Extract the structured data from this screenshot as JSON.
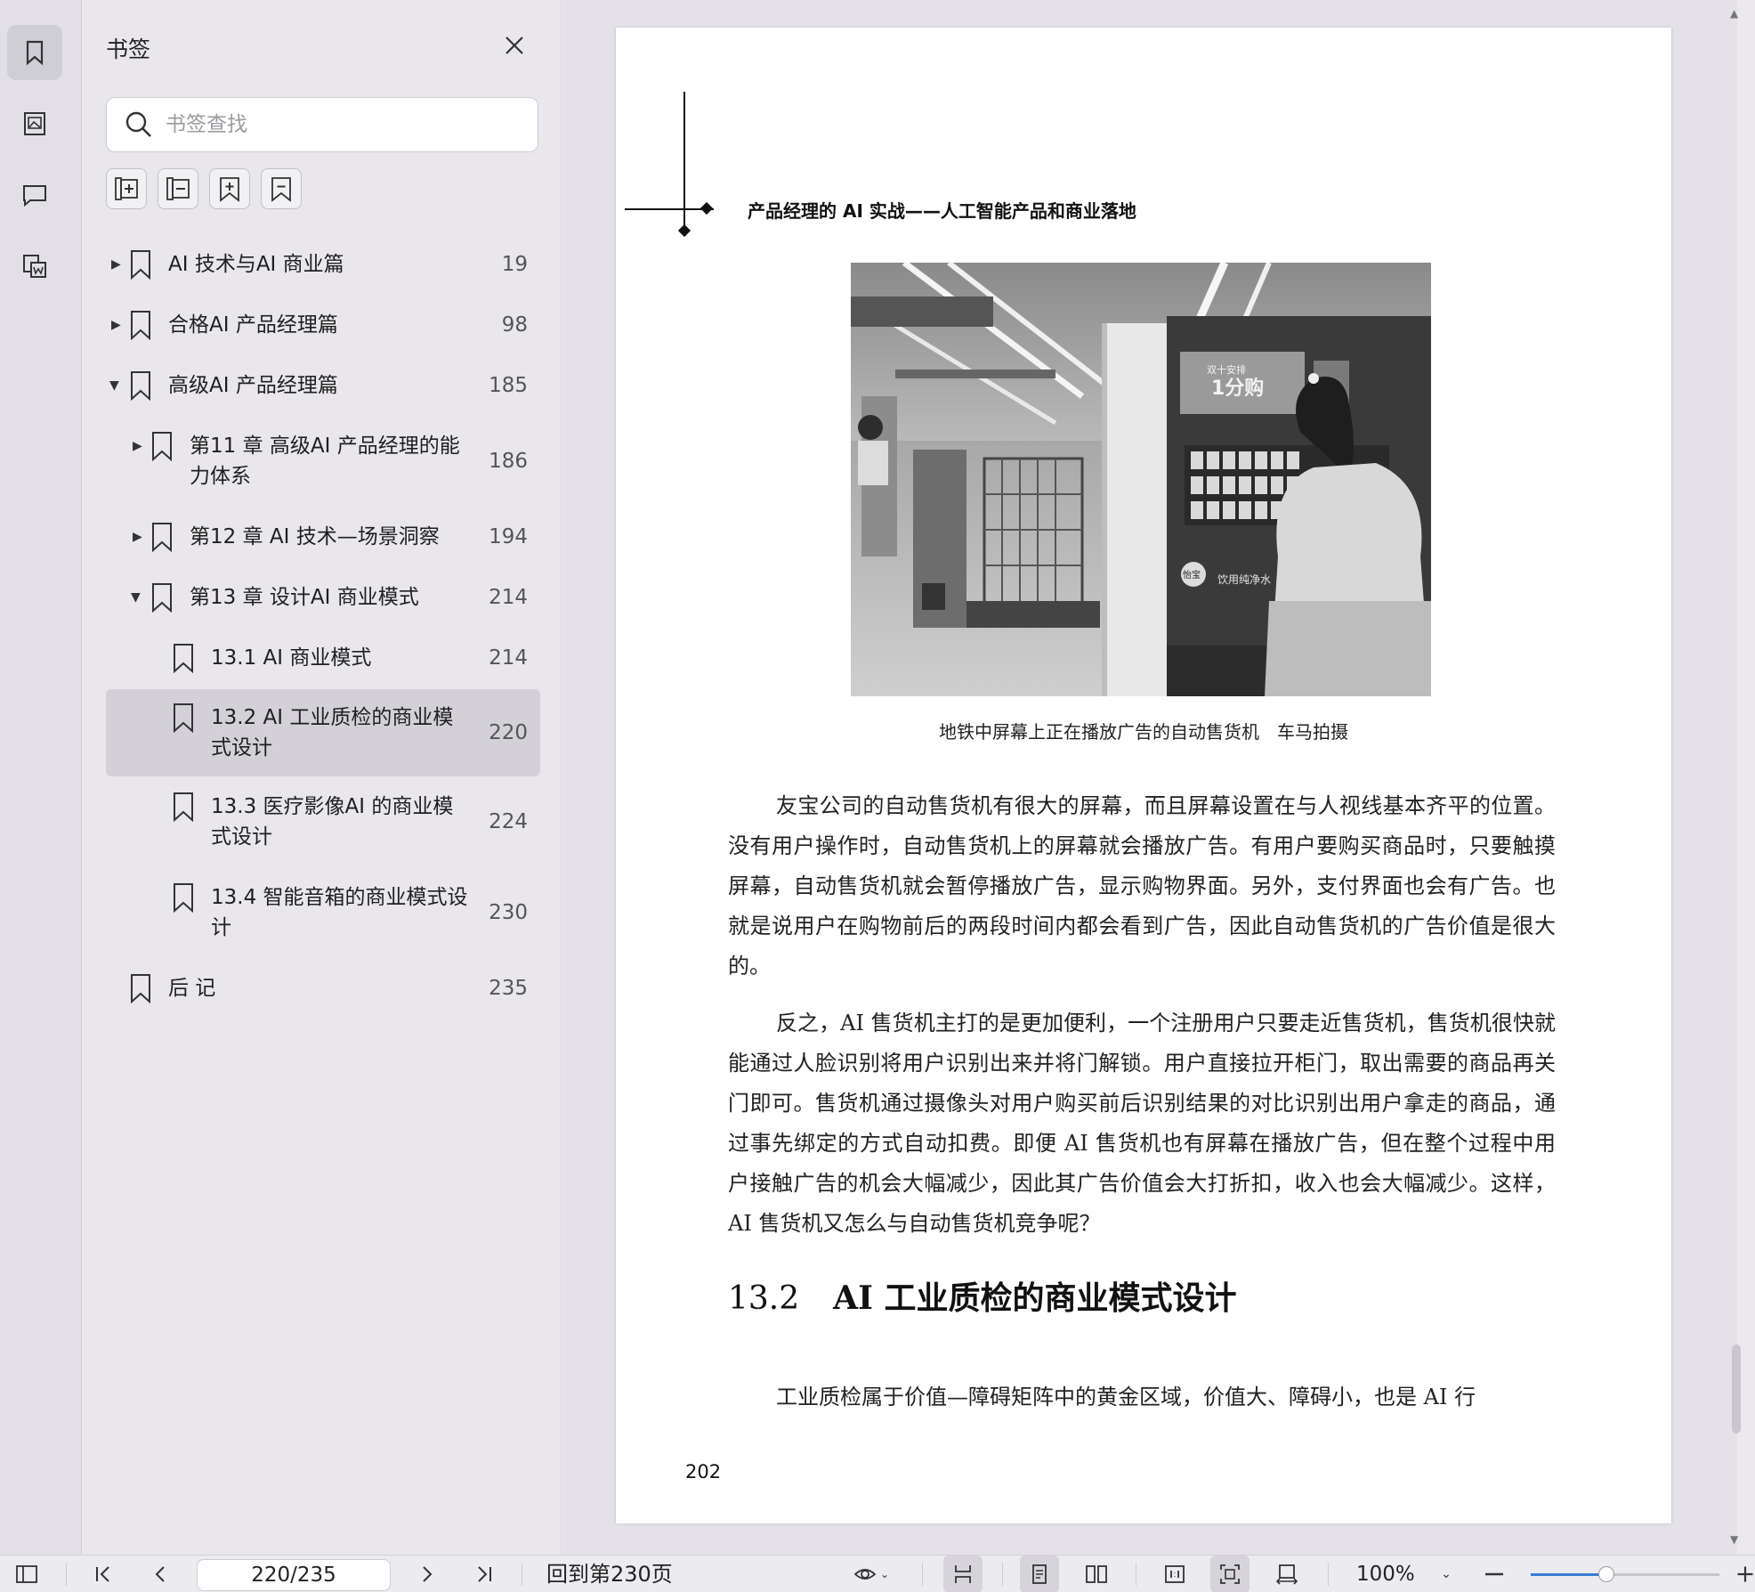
{
  "sidebar_panel": {
    "title": "书签",
    "search_placeholder": "书签查找"
  },
  "rail": {
    "items": [
      {
        "name": "bookmark-icon",
        "active": true
      },
      {
        "name": "thumbnail-icon",
        "active": false
      },
      {
        "name": "comment-icon",
        "active": false
      },
      {
        "name": "word-export-icon",
        "active": false
      }
    ]
  },
  "bookmark_tools": [
    "expand-all-icon",
    "collapse-all-icon",
    "add-bookmark-icon",
    "remove-bookmark-icon"
  ],
  "bookmarks": [
    {
      "label": "AI 技术与AI 商业篇",
      "page": "19",
      "level": 0,
      "arrow": "right"
    },
    {
      "label": "合格AI 产品经理篇",
      "page": "98",
      "level": 0,
      "arrow": "right"
    },
    {
      "label": "高级AI 产品经理篇",
      "page": "185",
      "level": 0,
      "arrow": "down"
    },
    {
      "label": "第11 章 高级AI 产品经理的能力体系",
      "page": "186",
      "level": 1,
      "arrow": "right"
    },
    {
      "label": "第12 章 AI 技术—场景洞察",
      "page": "194",
      "level": 1,
      "arrow": "right"
    },
    {
      "label": "第13 章 设计AI 商业模式",
      "page": "214",
      "level": 1,
      "arrow": "down"
    },
    {
      "label": "13.1 AI 商业模式",
      "page": "214",
      "level": 2,
      "arrow": ""
    },
    {
      "label": "13.2 AI 工业质检的商业模式设计",
      "page": "220",
      "level": 2,
      "arrow": "",
      "selected": true
    },
    {
      "label": "13.3 医疗影像AI 的商业模式设计",
      "page": "224",
      "level": 2,
      "arrow": ""
    },
    {
      "label": "13.4 智能音箱的商业模式设计",
      "page": "230",
      "level": 2,
      "arrow": ""
    },
    {
      "label": "后 记",
      "page": "235",
      "level": 0,
      "arrow": ""
    }
  ],
  "document": {
    "running_head": "产品经理的 AI 实战——人工智能产品和商业落地",
    "caption": "地铁中屏幕上正在播放广告的自动售货机　车马拍摄",
    "paragraphs": [
      "友宝公司的自动售货机有很大的屏幕，而且屏幕设置在与人视线基本齐平的位置。没有用户操作时，自动售货机上的屏幕就会播放广告。有用户要购买商品时，只要触摸屏幕，自动售货机就会暂停播放广告，显示购物界面。另外，支付界面也会有广告。也就是说用户在购物前后的两段时间内都会看到广告，因此自动售货机的广告价值是很大的。",
      "反之，AI 售货机主打的是更加便利，一个注册用户只要走近售货机，售货机很快就能通过人脸识别将用户识别出来并将门解锁。用户直接拉开柜门，取出需要的商品再关门即可。售货机通过摄像头对用户购买前后识别结果的对比识别出用户拿走的商品，通过事先绑定的方式自动扣费。即便 AI 售货机也有屏幕在播放广告，但在整个过程中用户接触广告的机会大幅减少，因此其广告价值会大打折扣，收入也会大幅减少。这样，AI 售货机又怎么与自动售货机竞争呢？",
      "工业质检属于价值—障碍矩阵中的黄金区域，价值大、障碍小，也是 AI 行"
    ],
    "heading_number": "13.2",
    "heading_text": "AI 工业质检的商业模式设计",
    "page_number": "202",
    "photo_signs": {
      "screen_banner": "1分购",
      "screen_small": "双十安排",
      "brand_logo": "怡宝",
      "machine_tagline": "饮用纯净水"
    }
  },
  "toolbar": {
    "page_field": "220/235",
    "goto_label": "回到第230页",
    "zoom_label": "100%",
    "zoom_slider_fraction": 0.4
  },
  "colors": {
    "accent": "#3a7bd5",
    "selected_row": "#d3d1d7",
    "panel_bg": "#e9e7ec"
  }
}
